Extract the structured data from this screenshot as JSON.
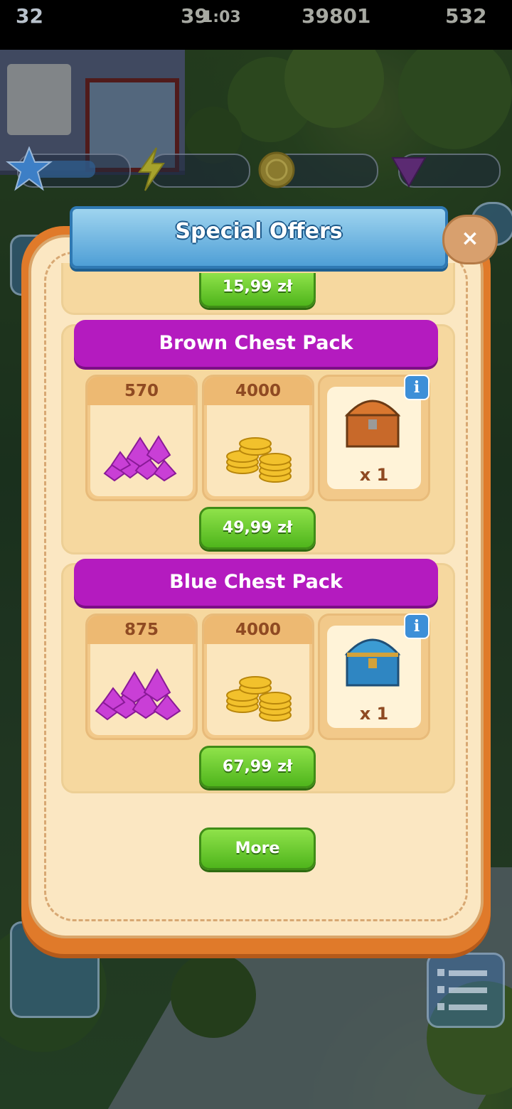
{
  "hud": {
    "level": "32",
    "energy": "39",
    "timer": "1:03",
    "coins": "39801",
    "gems": "532"
  },
  "popup": {
    "title": "Special Offers",
    "close_label": "×",
    "previous_price": "15,99 zł",
    "more_label": "More"
  },
  "packs": [
    {
      "title": "Brown Chest Pack",
      "gems": "570",
      "coins": "4000",
      "chest_qty": "x 1",
      "price": "49,99 zł",
      "chest_icon": "brown-chest-icon"
    },
    {
      "title": "Blue Chest Pack",
      "gems": "875",
      "coins": "4000",
      "chest_qty": "x 1",
      "price": "67,99 zł",
      "chest_icon": "blue-chest-icon"
    }
  ],
  "info_label": "i",
  "colors": {
    "pack_header": "#b41bbf",
    "buy_button": "#5fbf22",
    "popup_frame": "#e07a2a",
    "ribbon": "#4f9fd6"
  }
}
